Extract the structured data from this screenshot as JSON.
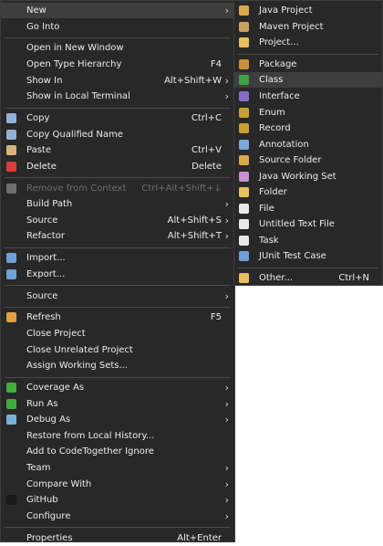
{
  "main_menu": {
    "items": [
      {
        "name": "menu-item-new",
        "label": "New",
        "submenu": true,
        "highlight": true
      },
      {
        "name": "menu-item-go-into",
        "label": "Go Into"
      },
      {
        "sep": true
      },
      {
        "name": "menu-item-open-in-new-window",
        "label": "Open in New Window"
      },
      {
        "name": "menu-item-open-type-hierarchy",
        "label": "Open Type Hierarchy",
        "shortcut": "F4"
      },
      {
        "name": "menu-item-show-in",
        "label": "Show In",
        "shortcut": "Alt+Shift+W",
        "submenu": true
      },
      {
        "name": "menu-item-show-in-local-terminal",
        "label": "Show in Local Terminal",
        "submenu": true
      },
      {
        "sep": true
      },
      {
        "name": "menu-item-copy",
        "label": "Copy",
        "shortcut": "Ctrl+C",
        "icon": "copy-icon",
        "icon_color": "#8fb3d9"
      },
      {
        "name": "menu-item-copy-qualified-name",
        "label": "Copy Qualified Name",
        "icon": "copy-qualified-name-icon",
        "icon_color": "#8fb3d9"
      },
      {
        "name": "menu-item-paste",
        "label": "Paste",
        "shortcut": "Ctrl+V",
        "icon": "paste-icon",
        "icon_color": "#d8b37a"
      },
      {
        "name": "menu-item-delete",
        "label": "Delete",
        "shortcut": "Delete",
        "icon": "delete-icon",
        "icon_color": "#e03c3c"
      },
      {
        "sep": true
      },
      {
        "name": "menu-item-remove-from-context",
        "label": "Remove from Context",
        "shortcut": "Ctrl+Alt+Shift+↓",
        "icon": "remove-context-icon",
        "icon_color": "#6e6e6e",
        "disabled": true
      },
      {
        "name": "menu-item-build-path",
        "label": "Build Path",
        "submenu": true
      },
      {
        "name": "menu-item-source",
        "label": "Source",
        "shortcut": "Alt+Shift+S",
        "submenu": true
      },
      {
        "name": "menu-item-refactor",
        "label": "Refactor",
        "shortcut": "Alt+Shift+T",
        "submenu": true
      },
      {
        "sep": true
      },
      {
        "name": "menu-item-import",
        "label": "Import...",
        "icon": "import-icon",
        "icon_color": "#6fa0d8"
      },
      {
        "name": "menu-item-export",
        "label": "Export...",
        "icon": "export-icon",
        "icon_color": "#6fa0d8"
      },
      {
        "sep": true
      },
      {
        "name": "menu-item-source-2",
        "label": "Source",
        "submenu": true
      },
      {
        "sep": true
      },
      {
        "name": "menu-item-refresh",
        "label": "Refresh",
        "shortcut": "F5",
        "icon": "refresh-icon",
        "icon_color": "#e0a040"
      },
      {
        "name": "menu-item-close-project",
        "label": "Close Project"
      },
      {
        "name": "menu-item-close-unrelated-project",
        "label": "Close Unrelated Project"
      },
      {
        "name": "menu-item-assign-working-sets",
        "label": "Assign Working Sets..."
      },
      {
        "sep": true
      },
      {
        "name": "menu-item-coverage-as",
        "label": "Coverage As",
        "submenu": true,
        "icon": "coverage-icon",
        "icon_color": "#3fae3f"
      },
      {
        "name": "menu-item-run-as",
        "label": "Run As",
        "submenu": true,
        "icon": "run-icon",
        "icon_color": "#3fae3f"
      },
      {
        "name": "menu-item-debug-as",
        "label": "Debug As",
        "submenu": true,
        "icon": "debug-icon",
        "icon_color": "#7ab0d8"
      },
      {
        "name": "menu-item-restore-from-local-history",
        "label": "Restore from Local History..."
      },
      {
        "name": "menu-item-add-to-codetogether-ignore",
        "label": "Add to CodeTogether Ignore"
      },
      {
        "name": "menu-item-team",
        "label": "Team",
        "submenu": true
      },
      {
        "name": "menu-item-compare-with",
        "label": "Compare With",
        "submenu": true
      },
      {
        "name": "menu-item-github",
        "label": "GitHub",
        "submenu": true,
        "icon": "github-icon",
        "icon_color": "#1a1a1a"
      },
      {
        "name": "menu-item-configure",
        "label": "Configure",
        "submenu": true
      },
      {
        "sep": true
      },
      {
        "name": "menu-item-properties",
        "label": "Properties",
        "shortcut": "Alt+Enter"
      }
    ]
  },
  "new_submenu": {
    "items": [
      {
        "name": "submenu-item-java-project",
        "label": "Java Project",
        "icon": "java-project-icon",
        "icon_color": "#d8a84a"
      },
      {
        "name": "submenu-item-maven-project",
        "label": "Maven Project",
        "icon": "maven-project-icon",
        "icon_color": "#c8a060"
      },
      {
        "name": "submenu-item-project",
        "label": "Project...",
        "icon": "project-icon",
        "icon_color": "#e8c060"
      },
      {
        "sep": true
      },
      {
        "name": "submenu-item-package",
        "label": "Package",
        "icon": "package-icon",
        "icon_color": "#c8903a"
      },
      {
        "name": "submenu-item-class",
        "label": "Class",
        "icon": "class-icon",
        "icon_color": "#3fa046",
        "highlight": true
      },
      {
        "name": "submenu-item-interface",
        "label": "Interface",
        "icon": "interface-icon",
        "icon_color": "#8a6ac8"
      },
      {
        "name": "submenu-item-enum",
        "label": "Enum",
        "icon": "enum-icon",
        "icon_color": "#c8a030"
      },
      {
        "name": "submenu-item-record",
        "label": "Record",
        "icon": "record-icon",
        "icon_color": "#c8a030"
      },
      {
        "name": "submenu-item-annotation",
        "label": "Annotation",
        "icon": "annotation-icon",
        "icon_color": "#7aa8d8"
      },
      {
        "name": "submenu-item-source-folder",
        "label": "Source Folder",
        "icon": "source-folder-icon",
        "icon_color": "#d8a84a"
      },
      {
        "name": "submenu-item-java-working-set",
        "label": "Java Working Set",
        "icon": "java-working-set-icon",
        "icon_color": "#c890d0"
      },
      {
        "name": "submenu-item-folder",
        "label": "Folder",
        "icon": "folder-icon",
        "icon_color": "#e8c060"
      },
      {
        "name": "submenu-item-file",
        "label": "File",
        "icon": "file-icon",
        "icon_color": "#e8e8e8"
      },
      {
        "name": "submenu-item-untitled-text-file",
        "label": "Untitled Text File",
        "icon": "text-file-icon",
        "icon_color": "#e8e8e8"
      },
      {
        "name": "submenu-item-task",
        "label": "Task",
        "icon": "task-icon",
        "icon_color": "#e8e8e8"
      },
      {
        "name": "submenu-item-junit-test-case",
        "label": "JUnit Test Case",
        "icon": "junit-icon",
        "icon_color": "#6fa0d8"
      },
      {
        "sep": true
      },
      {
        "name": "submenu-item-other",
        "label": "Other...",
        "shortcut": "Ctrl+N",
        "icon": "other-icon",
        "icon_color": "#e8c060"
      }
    ]
  }
}
